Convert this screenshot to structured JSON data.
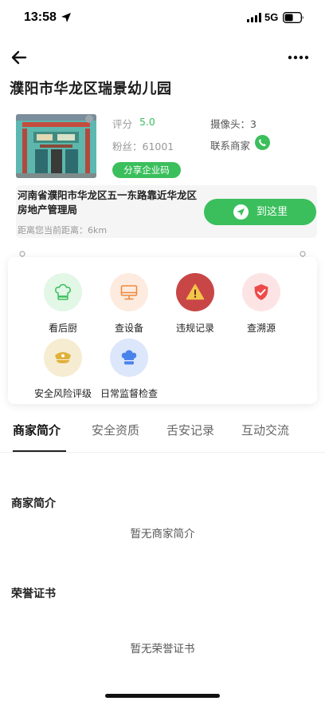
{
  "status_bar": {
    "time": "13:58",
    "network": "5G"
  },
  "page": {
    "title": "濮阳市华龙区瑞景幼儿园"
  },
  "store": {
    "score_label": "评分",
    "score_value": "5.0",
    "camera": "摄像头：3",
    "fans": "粉丝：61001",
    "contact_label": "联系商家",
    "share_button": "分享企业码"
  },
  "address": {
    "text": "河南省濮阳市华龙区五一东路靠近华龙区房地产管理局",
    "distance": "距离您当前距离：6km",
    "go_button": "到这里"
  },
  "features": [
    {
      "label": "看后厨",
      "icon": "chef-hat-icon",
      "bg": "#e2f7e6",
      "color": "#3bbf5c"
    },
    {
      "label": "查设备",
      "icon": "monitor-icon",
      "bg": "#fdebdf",
      "color": "#f08a3c"
    },
    {
      "label": "违规记录",
      "icon": "warning-icon",
      "bg": "#c94646",
      "color": "#f3c54a"
    },
    {
      "label": "查溯源",
      "icon": "shield-check-icon",
      "bg": "#fde4e4",
      "color": "#ee4a4a"
    },
    {
      "label": "安全风险评级",
      "icon": "police-cap-icon",
      "bg": "#f6ecd2",
      "color": "#e0b13a"
    },
    {
      "label": "日常监督检查",
      "icon": "chef-hat-icon",
      "bg": "#dde7fb",
      "color": "#4a83ea"
    }
  ],
  "tabs": [
    {
      "label": "商家简介",
      "active": true
    },
    {
      "label": "安全资质",
      "active": false
    },
    {
      "label": "舌安记录",
      "active": false
    },
    {
      "label": "互动交流",
      "active": false
    }
  ],
  "intro": {
    "title": "商家简介",
    "empty": "暂无商家简介"
  },
  "honor": {
    "title": "荣誉证书",
    "empty": "暂无荣誉证书"
  },
  "colors": {
    "accent": "#3bbf5c"
  }
}
